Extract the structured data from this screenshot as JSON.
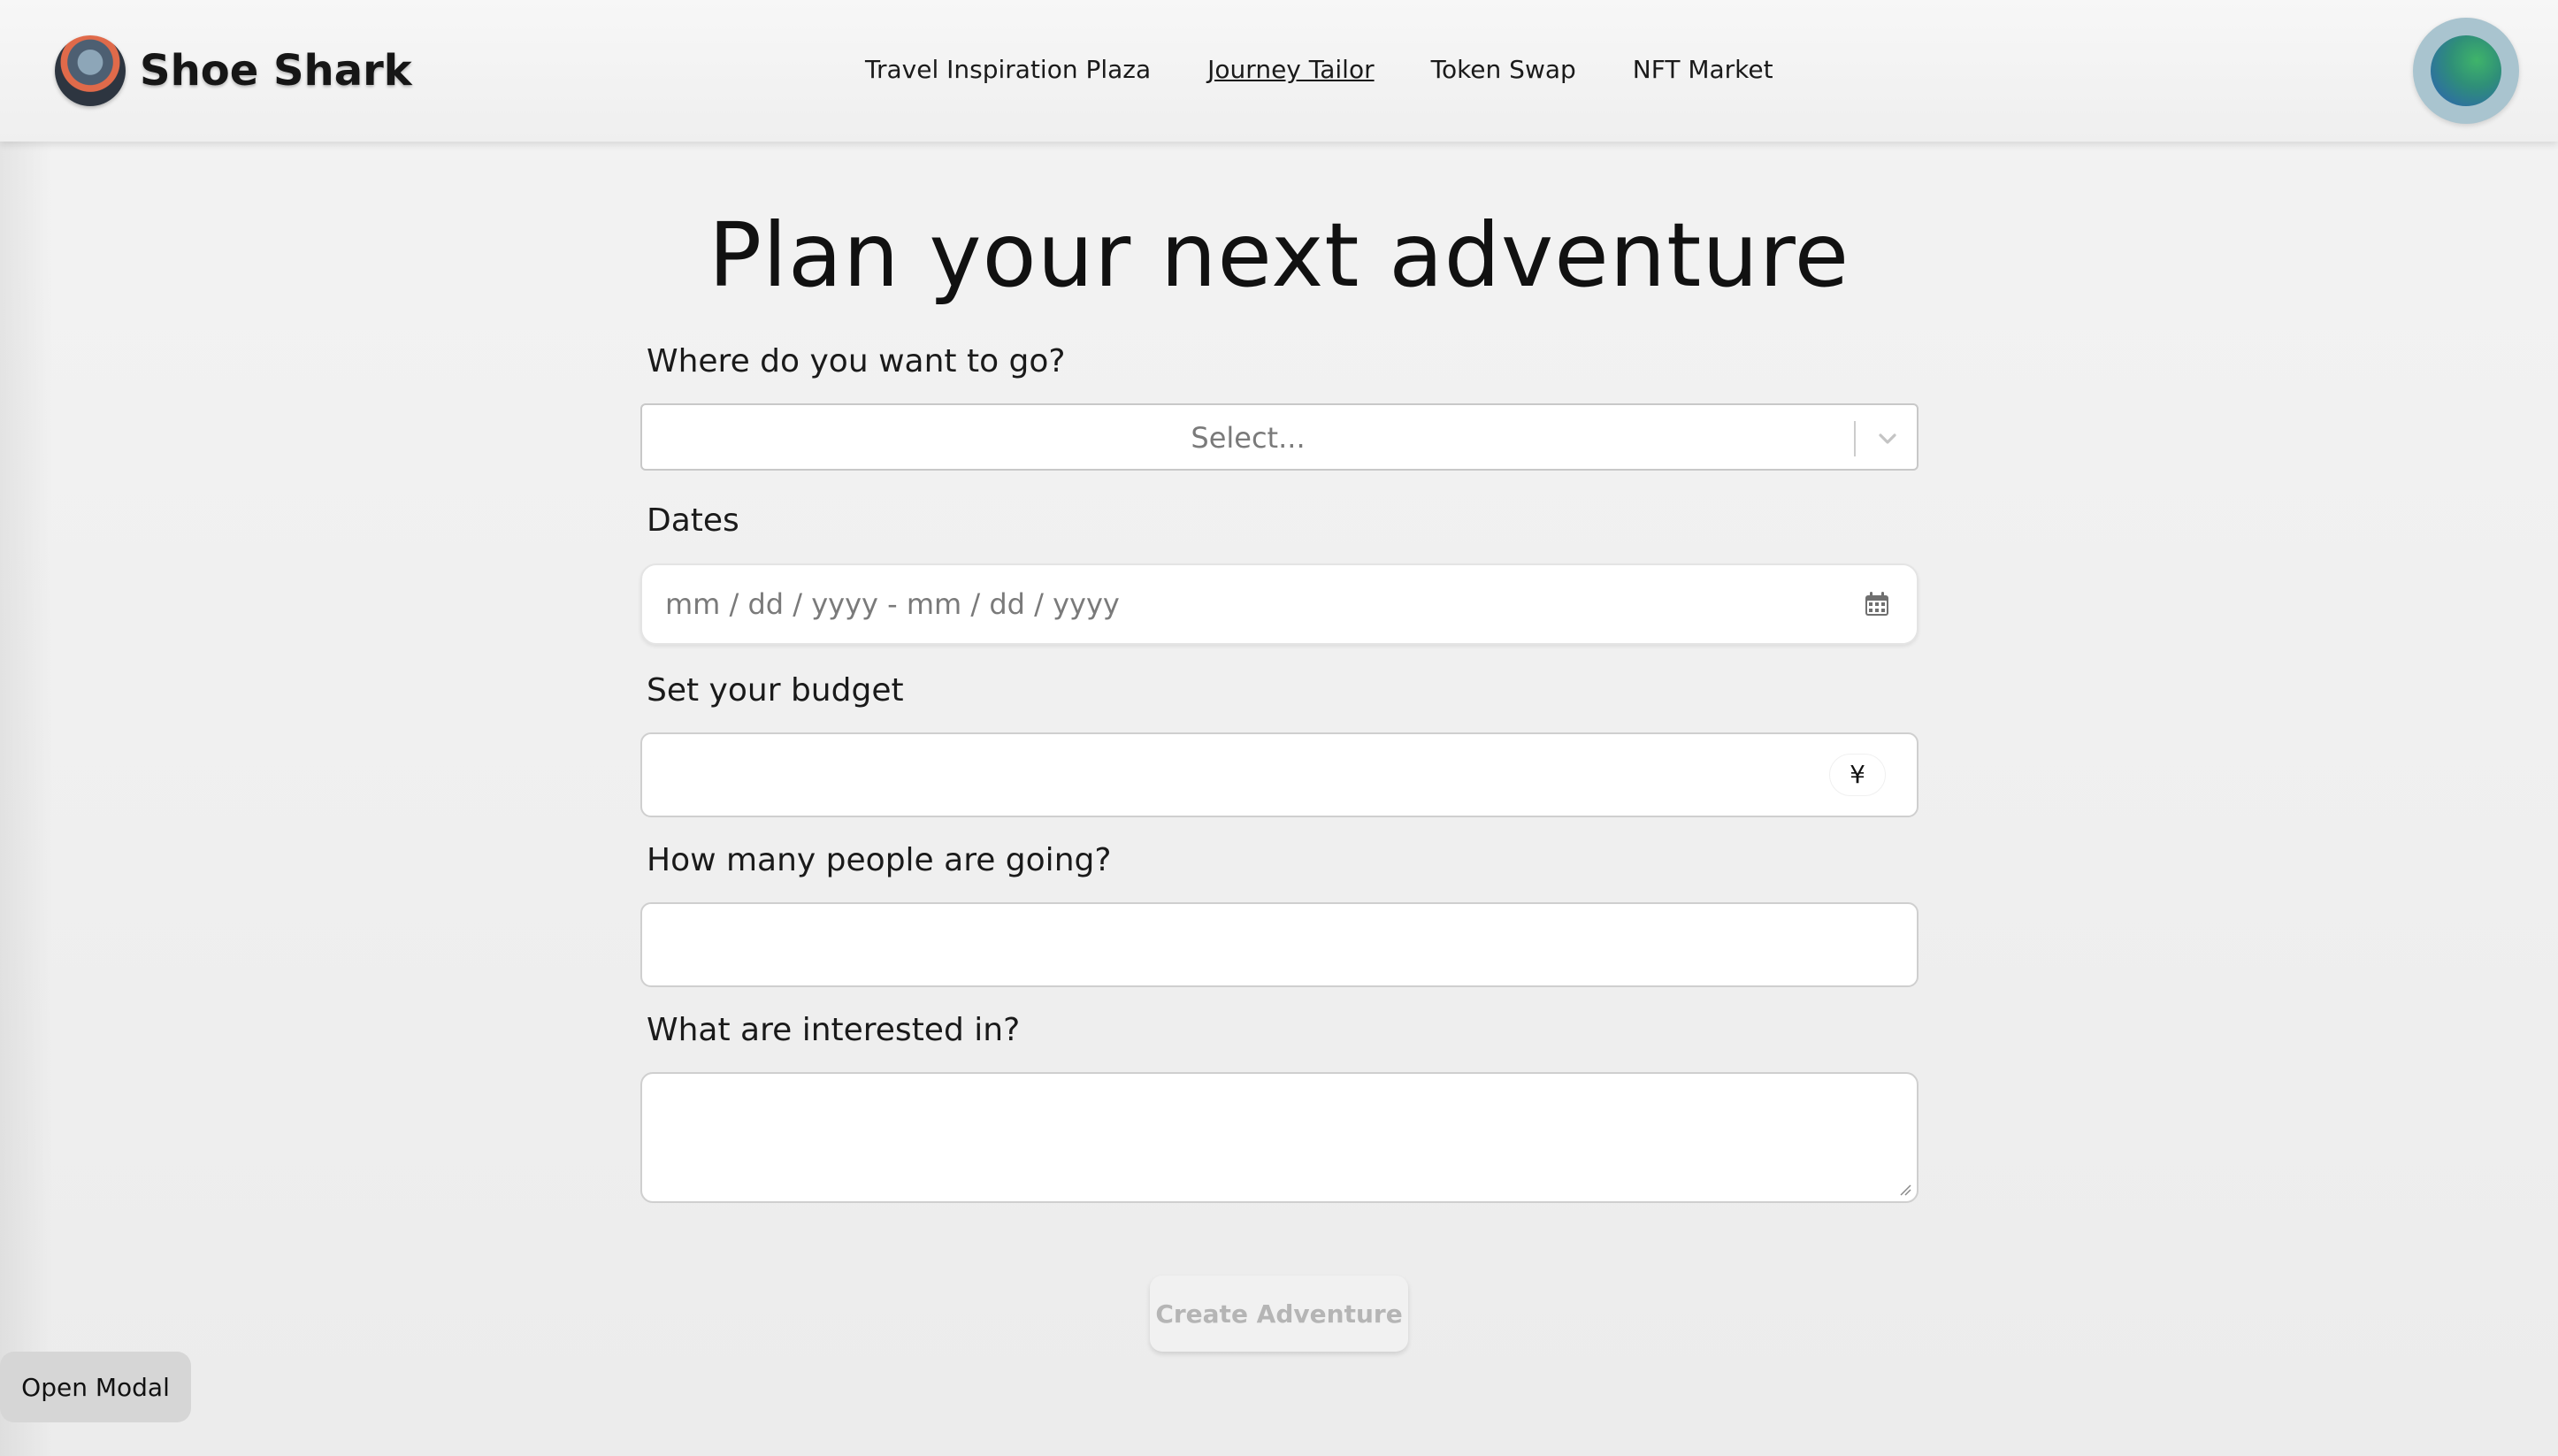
{
  "header": {
    "brand": "Shoe Shark",
    "nav": [
      {
        "label": "Travel Inspiration Plaza"
      },
      {
        "label": "Journey Tailor",
        "active": true
      },
      {
        "label": "Token Swap"
      },
      {
        "label": "NFT Market"
      }
    ]
  },
  "main": {
    "title": "Plan your next adventure",
    "destination": {
      "label": "Where do you want to go?",
      "placeholder": "Select..."
    },
    "dates": {
      "label": "Dates",
      "placeholder": "mm / dd / yyyy  - mm / dd / yyyy"
    },
    "budget": {
      "label": "Set your budget",
      "currency": "¥",
      "value": ""
    },
    "people": {
      "label": "How many people are going?",
      "value": ""
    },
    "interests": {
      "label": "What are interested in?",
      "value": ""
    },
    "submit_label": "Create Adventure"
  },
  "footer": {
    "open_modal_label": "Open Modal"
  },
  "colors": {
    "avatar_ring": "#a9c4cf",
    "disabled_text": "#b5b5b5"
  },
  "icons": {
    "logo": "shark-logo-icon",
    "chevron": "chevron-down-icon",
    "calendar": "calendar-icon",
    "currency": "yen-icon"
  }
}
